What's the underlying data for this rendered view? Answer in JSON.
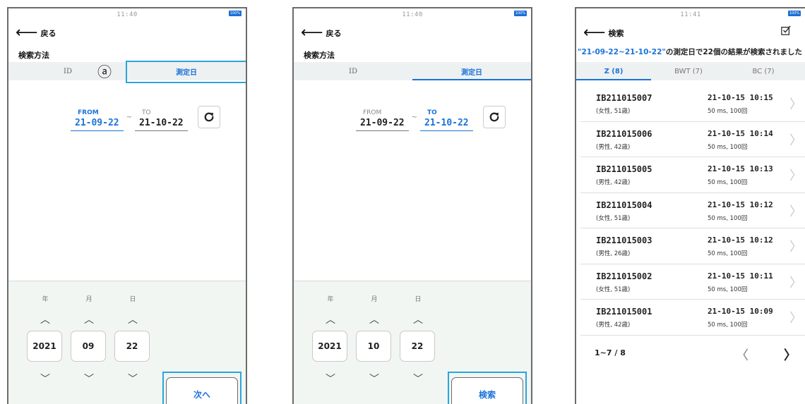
{
  "screen1": {
    "clock": "11:40",
    "battery": "100%",
    "back_label": "戻る",
    "section_title": "検索方法",
    "tabs": [
      {
        "label": "ID",
        "active": false
      },
      {
        "label": "測定日",
        "active": true
      }
    ],
    "marker": "ⓐ",
    "from_label": "FROM",
    "from_value": "21-09-22",
    "separator": "~",
    "to_label": "TO",
    "to_value": "21-10-22",
    "picker": {
      "units": [
        "年",
        "月",
        "日"
      ],
      "values": [
        "2021",
        "09",
        "22"
      ]
    },
    "action_label": "次へ"
  },
  "screen2": {
    "clock": "11:40",
    "battery": "100%",
    "back_label": "戻る",
    "section_title": "検索方法",
    "tabs": [
      {
        "label": "ID",
        "active": false
      },
      {
        "label": "測定日",
        "active": true
      }
    ],
    "from_label": "FROM",
    "from_value": "21-09-22",
    "separator": "~",
    "to_label": "TO",
    "to_value": "21-10-22",
    "picker": {
      "units": [
        "年",
        "月",
        "日"
      ],
      "values": [
        "2021",
        "10",
        "22"
      ]
    },
    "action_label": "検索"
  },
  "screen3": {
    "clock": "11:41",
    "battery": "100%",
    "back_label": "検索",
    "summary_quoted": "\"21-09-22~21-10-22\"",
    "summary_rest": "の測定日で22個の結果が検索されました",
    "tabs": [
      {
        "label": "Z (8)",
        "active": true
      },
      {
        "label": "BWT (7)",
        "active": false
      },
      {
        "label": "BC (7)",
        "active": false
      }
    ],
    "results": [
      {
        "id": "IB211015007",
        "sub": "(女性, 51歳)",
        "time": "21-10-15 10:15",
        "meta": "50 ms, 100回"
      },
      {
        "id": "IB211015006",
        "sub": "(男性, 42歳)",
        "time": "21-10-15 10:14",
        "meta": "50 ms, 100回"
      },
      {
        "id": "IB211015005",
        "sub": "(男性, 42歳)",
        "time": "21-10-15 10:13",
        "meta": "50 ms, 100回"
      },
      {
        "id": "IB211015004",
        "sub": "(女性, 51歳)",
        "time": "21-10-15 10:12",
        "meta": "50 ms, 100回"
      },
      {
        "id": "IB211015003",
        "sub": "(男性, 26歳)",
        "time": "21-10-15 10:12",
        "meta": "50 ms, 100回"
      },
      {
        "id": "IB211015002",
        "sub": "(女性, 51歳)",
        "time": "21-10-15 10:11",
        "meta": "50 ms, 100回"
      },
      {
        "id": "IB211015001",
        "sub": "(男性, 42歳)",
        "time": "21-10-15 10:09",
        "meta": "50 ms, 100回"
      }
    ],
    "pager": {
      "label": "1~7 / 8",
      "prev": "〈",
      "next": "〉"
    }
  },
  "colors": {
    "accent": "#1a73d8",
    "highlight": "#2aa5dd",
    "picker_bg": "#f1f6f3",
    "tab_bg": "#eef1f1"
  },
  "icons": {
    "back": "left-arrow-icon",
    "refresh": "refresh-icon",
    "check": "checkbox-icon",
    "up": "chevron-up-icon",
    "down": "chevron-down-icon",
    "row": "chevron-right-icon"
  }
}
